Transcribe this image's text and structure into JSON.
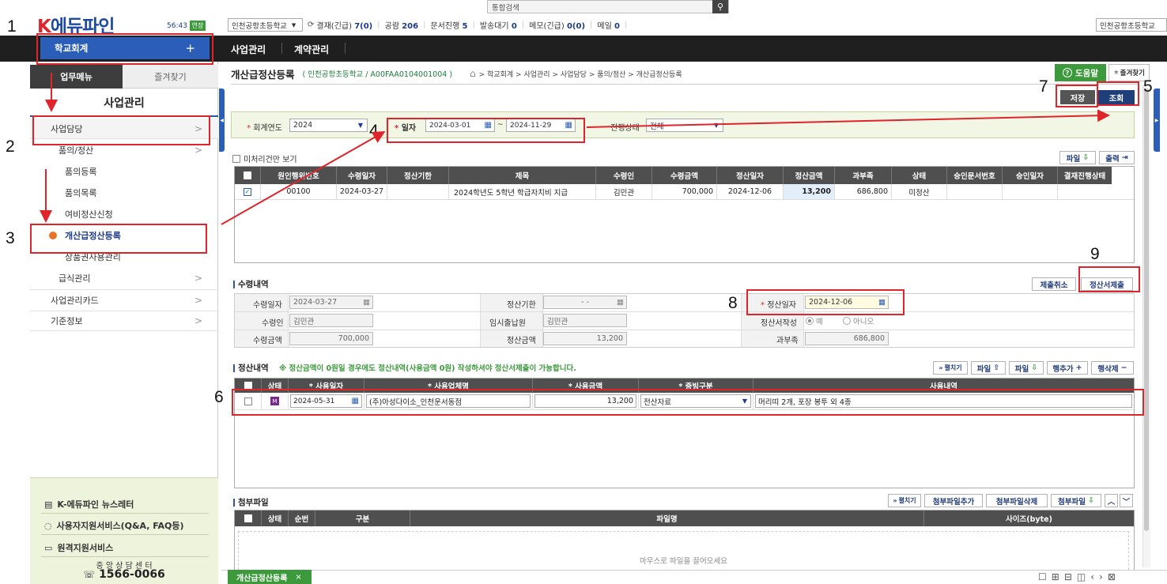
{
  "top": {
    "logo": "K에듀파인",
    "session_time": "56:43",
    "extend_label": "연장",
    "search_placeholder": "통합검색",
    "school_select": "인천공항초등학교",
    "status_items": [
      {
        "label": "결재(긴급)",
        "value": "7(0)"
      },
      {
        "label": "공람",
        "value": "206"
      },
      {
        "label": "문서진행",
        "value": "5"
      },
      {
        "label": "발송대기",
        "value": "0"
      },
      {
        "label": "메모(긴급)",
        "value": "0(0)"
      },
      {
        "label": "메일",
        "value": "0"
      }
    ],
    "school_right": "인천공항초등학교"
  },
  "nav": {
    "module": "학교회계",
    "module_plus": "+",
    "tabs": [
      "사업관리",
      "계약관리"
    ]
  },
  "sidebar": {
    "tab_menu": "업무메뉴",
    "tab_fav": "즐겨찾기",
    "section_title": "사업관리",
    "items": [
      {
        "label": "사업담당",
        "level": 1
      },
      {
        "label": "품의/정산",
        "level": 2
      },
      {
        "label": "품의등록",
        "level": 3
      },
      {
        "label": "품의목록",
        "level": 3
      },
      {
        "label": "여비정산신청",
        "level": 3
      },
      {
        "label": "개산급정산등록",
        "level": 3
      },
      {
        "label": "상품권사용관리",
        "level": 3
      },
      {
        "label": "급식관리",
        "level": 2
      },
      {
        "label": "사업관리카드",
        "level": 1
      },
      {
        "label": "기준정보",
        "level": 1
      }
    ],
    "links": [
      "K-에듀파인 뉴스레터",
      "사용자지원서비스(Q&A, FAQ등)",
      "원격지원서비스"
    ],
    "center_label": "중 앙 상 담 센 터",
    "center_phone": "1566-0066"
  },
  "page": {
    "title": "개산급정산등록",
    "school": "인천공항초등학교",
    "code": "A00FAA0104001004",
    "breadcrumb": "> 학교회계 > 사업관리 > 사업담당 > 품의/정산 > 개산급정산등록",
    "help": "도움말",
    "fav": "즐겨찾기",
    "save": "저장",
    "query": "조회"
  },
  "filter": {
    "year_label": "회계연도",
    "year": "2024",
    "date_label": "일자",
    "date_from": "2024-03-01",
    "date_to": "2024-11-29",
    "status_label": "진행상태",
    "status": "전체"
  },
  "list": {
    "unprocessed_label": "미처리건만 보기",
    "file_btn": "파일",
    "print_btn": "출력",
    "headers": [
      "원인행위번호",
      "수령일자",
      "정산기한",
      "제목",
      "수령인",
      "수령금액",
      "정산일자",
      "정산금액",
      "과부족",
      "상태",
      "승인문서번호",
      "승인일자",
      "결재진행상태"
    ],
    "row": [
      "00100",
      "2024-03-27",
      "",
      "2024학년도 5학년 학급자치비 지급",
      "김민관",
      "700,000",
      "2024-12-06",
      "13,200",
      "686,800",
      "미정산",
      "",
      "",
      ""
    ]
  },
  "receipt": {
    "title": "수령내역",
    "cancel_btn": "제출취소",
    "submit_btn": "정산서제출",
    "recv_date_label": "수령일자",
    "recv_date": "2024-03-27",
    "deadline_label": "정산기한",
    "deadline": "- -",
    "settle_date_label": "정산일자",
    "settle_date": "2024-12-06",
    "recipient_label": "수령인",
    "recipient": "김민관",
    "temp_label": "임시출납원",
    "temp": "김민관",
    "write_label": "정산서작성",
    "yes": "예",
    "no": "아니오",
    "amount_label": "수령금액",
    "amount": "700,000",
    "settle_amt_label": "정산금액",
    "settle_amt": "13,200",
    "diff_label": "과부족",
    "diff": "686,800"
  },
  "detail": {
    "title": "정산내역",
    "notice": "※ 정산금액이 0원일 경우에도 정산내역(사용금액 0원) 작성하셔야 정산서제출이 가능합니다.",
    "btns": [
      "펼치기",
      "파일",
      "파일",
      "행추가",
      "행삭제"
    ],
    "headers": [
      "상태",
      "* 사용일자",
      "* 사용업체명",
      "* 사용금액",
      "* 증빙구분",
      "사용내역"
    ],
    "row": {
      "status": "M",
      "date": "2024-05-31",
      "vendor": "(주)아성다이소_인천운서동점",
      "amount": "13,200",
      "proof": "전산자료",
      "desc": "머리띠 2개, 포장 봉투 외 4종"
    }
  },
  "attach": {
    "title": "첨부파일",
    "btns": [
      "펼치기",
      "첨부파일추가",
      "첨부파일삭제",
      "첨부파일"
    ],
    "headers": [
      "상태",
      "순번",
      "구분",
      "파일명",
      "사이즈(byte)"
    ],
    "drop": "마우스로 파일을 끌어오세요"
  },
  "bottom": {
    "tab": "개산급정산등록",
    "close": "×"
  },
  "annotations": [
    "1",
    "2",
    "3",
    "4",
    "5",
    "6",
    "7",
    "8",
    "9"
  ]
}
